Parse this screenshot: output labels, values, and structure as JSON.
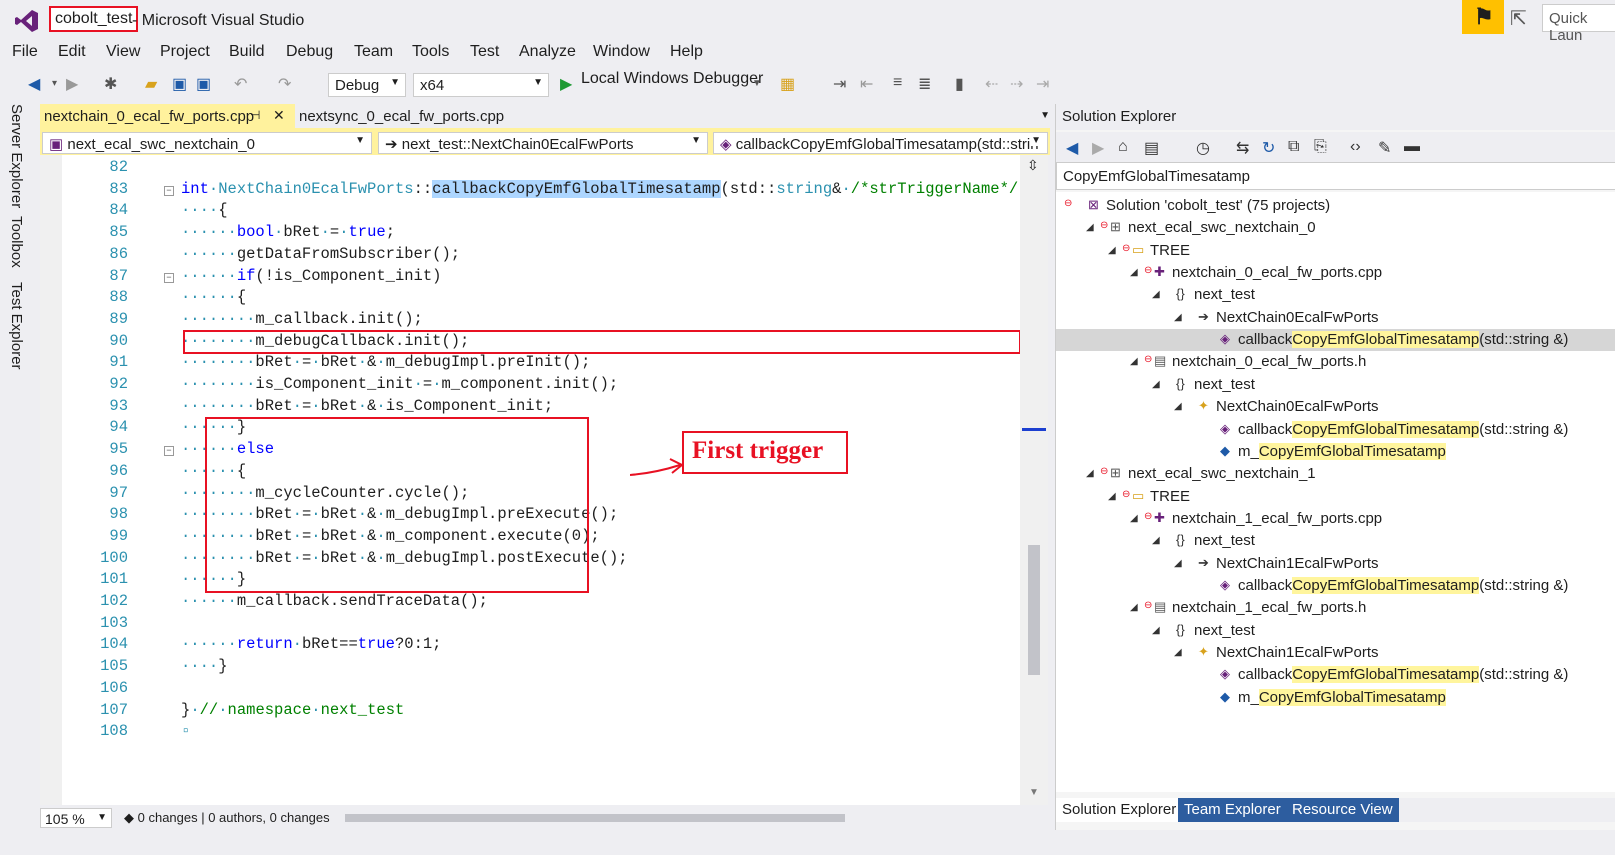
{
  "window": {
    "app_name": "cobolt_test",
    "title_suffix": " - Microsoft Visual Studio",
    "quick_launch_placeholder": "Quick Laun"
  },
  "menu": [
    "File",
    "Edit",
    "View",
    "Project",
    "Build",
    "Debug",
    "Team",
    "Tools",
    "Test",
    "Analyze",
    "Window",
    "Help"
  ],
  "toolbar": {
    "config": "Debug",
    "platform": "x64",
    "debugger": "Local Windows Debugger"
  },
  "side_tabs": [
    "Server Explorer",
    "Toolbox",
    "Test Explorer"
  ],
  "tabs": {
    "active": "nextchain_0_ecal_fw_ports.cpp",
    "pin": "⊣",
    "close": "✕",
    "inactive": "nextsync_0_ecal_fw_ports.cpp"
  },
  "nav": {
    "project": "next_ecal_swc_nextchain_0",
    "scope": "next_test::NextChain0EcalFwPorts",
    "member": "callbackCopyEmfGlobalTimesatamp(std::strin"
  },
  "code": {
    "lines": [
      {
        "n": "82",
        "html": ""
      },
      {
        "n": "83",
        "html": "<span class=\"kw\">int</span><span class=\"dot\">·</span><span class=\"ty\">NextChain0EcalFwPorts</span>::<span style=\"background:#add6ff\">callbackCopyEmfGlobalTimesatamp</span>(std::<span class=\"ty\">string</span>&amp;<span class=\"dot\">·</span><span class=\"cm\">/*strTriggerName*/</span>)"
      },
      {
        "n": "84",
        "html": "<span class=\"dot\">····</span>{"
      },
      {
        "n": "85",
        "html": "<span class=\"dot\">······</span><span class=\"kw\">bool</span><span class=\"dot\">·</span>bRet<span class=\"dot\">·</span>=<span class=\"dot\">·</span><span class=\"kw\">true</span>;"
      },
      {
        "n": "86",
        "html": "<span class=\"dot\">······</span>getDataFromSubscriber();"
      },
      {
        "n": "87",
        "html": "<span class=\"dot\">······</span><span class=\"kw\">if</span>(!is_Component_init)"
      },
      {
        "n": "88",
        "html": "<span class=\"dot\">······</span>{"
      },
      {
        "n": "89",
        "html": "<span class=\"dot\">········</span>m_callback.init();"
      },
      {
        "n": "90",
        "html": "<span class=\"dot\">········</span>m_debugCallback.init();"
      },
      {
        "n": "91",
        "html": "<span class=\"dot\">········</span>bRet<span class=\"dot\">·</span>=<span class=\"dot\">·</span>bRet<span class=\"dot\">·</span>&amp;<span class=\"dot\">·</span>m_debugImpl.preInit();"
      },
      {
        "n": "92",
        "html": "<span class=\"dot\">········</span>is_Component_init<span class=\"dot\">·</span>=<span class=\"dot\">·</span>m_component.init();"
      },
      {
        "n": "93",
        "html": "<span class=\"dot\">········</span>bRet<span class=\"dot\">·</span>=<span class=\"dot\">·</span>bRet<span class=\"dot\">·</span>&amp;<span class=\"dot\">·</span>is_Component_init;"
      },
      {
        "n": "94",
        "html": "<span class=\"dot\">······</span>}"
      },
      {
        "n": "95",
        "html": "<span class=\"dot\">······</span><span class=\"kw\">else</span>"
      },
      {
        "n": "96",
        "html": "<span class=\"dot\">······</span>{"
      },
      {
        "n": "97",
        "html": "<span class=\"dot\">········</span>m_cycleCounter.cycle();"
      },
      {
        "n": "98",
        "html": "<span class=\"dot\">········</span>bRet<span class=\"dot\">·</span>=<span class=\"dot\">·</span>bRet<span class=\"dot\">·</span>&amp;<span class=\"dot\">·</span>m_debugImpl.preExecute();"
      },
      {
        "n": "99",
        "html": "<span class=\"dot\">········</span>bRet<span class=\"dot\">·</span>=<span class=\"dot\">·</span>bRet<span class=\"dot\">·</span>&amp;<span class=\"dot\">·</span>m_component.execute(0);"
      },
      {
        "n": "100",
        "html": "<span class=\"dot\">········</span>bRet<span class=\"dot\">·</span>=<span class=\"dot\">·</span>bRet<span class=\"dot\">·</span>&amp;<span class=\"dot\">·</span>m_debugImpl.postExecute();"
      },
      {
        "n": "101",
        "html": "<span class=\"dot\">······</span>}"
      },
      {
        "n": "102",
        "html": "<span class=\"dot\">······</span>m_callback.sendTraceData();"
      },
      {
        "n": "103",
        "html": ""
      },
      {
        "n": "104",
        "html": "<span class=\"dot\">······</span><span class=\"kw\">return</span><span class=\"dot\">·</span>bRet==<span class=\"kw\">true</span>?0:1;"
      },
      {
        "n": "105",
        "html": "<span class=\"dot\">····</span>}"
      },
      {
        "n": "106",
        "html": ""
      },
      {
        "n": "107",
        "html": "}<span class=\"dot\">·</span><span class=\"cm\">//<span class=\"dot\">·</span>namespace<span class=\"dot\">·</span>next_test</span>"
      },
      {
        "n": "108",
        "html": "<span class=\"dot\">▫</span>"
      }
    ]
  },
  "callout": "First trigger",
  "status": {
    "zoom": "105 %",
    "changes": "0 changes | 0 authors, 0 changes"
  },
  "solution_explorer": {
    "title": "Solution Explorer",
    "search": "CopyEmfGlobalTimesatamp",
    "tree": [
      {
        "label": "Solution 'cobolt_test' (75 projects)",
        "d": 0,
        "ic": "sol",
        "exp": ""
      },
      {
        "label": "next_ecal_swc_nextchain_0",
        "d": 1,
        "ic": "proj",
        "exp": "◢"
      },
      {
        "label": "TREE",
        "d": 2,
        "ic": "folder",
        "exp": "◢"
      },
      {
        "label": "nextchain_0_ecal_fw_ports.cpp",
        "d": 3,
        "ic": "cpp",
        "exp": "◢"
      },
      {
        "label": "next_test",
        "d": 4,
        "ic": "ns",
        "exp": "◢"
      },
      {
        "label": "NextChain0EcalFwPorts",
        "d": 5,
        "ic": "arrow",
        "exp": "◢"
      },
      {
        "pre": "callback",
        "hl": "CopyEmfGlobalTimesatamp",
        "post": "(std::string &)",
        "d": 6,
        "ic": "method",
        "exp": "",
        "sel": true
      },
      {
        "label": "nextchain_0_ecal_fw_ports.h",
        "d": 3,
        "ic": "h",
        "exp": "◢"
      },
      {
        "label": "next_test",
        "d": 4,
        "ic": "ns",
        "exp": "◢"
      },
      {
        "label": "NextChain0EcalFwPorts",
        "d": 5,
        "ic": "class",
        "exp": "◢"
      },
      {
        "pre": "callback",
        "hl": "CopyEmfGlobalTimesatamp",
        "post": "(std::string &)",
        "d": 6,
        "ic": "method",
        "exp": ""
      },
      {
        "pre": "m_",
        "hl": "CopyEmfGlobalTimesatamp",
        "post": "",
        "d": 6,
        "ic": "field",
        "exp": ""
      },
      {
        "label": "next_ecal_swc_nextchain_1",
        "d": 1,
        "ic": "proj",
        "exp": "◢"
      },
      {
        "label": "TREE",
        "d": 2,
        "ic": "folder",
        "exp": "◢"
      },
      {
        "label": "nextchain_1_ecal_fw_ports.cpp",
        "d": 3,
        "ic": "cpp",
        "exp": "◢"
      },
      {
        "label": "next_test",
        "d": 4,
        "ic": "ns",
        "exp": "◢"
      },
      {
        "label": "NextChain1EcalFwPorts",
        "d": 5,
        "ic": "arrow",
        "exp": "◢"
      },
      {
        "pre": "callback",
        "hl": "CopyEmfGlobalTimesatamp",
        "post": "(std::string &)",
        "d": 6,
        "ic": "method",
        "exp": ""
      },
      {
        "label": "nextchain_1_ecal_fw_ports.h",
        "d": 3,
        "ic": "h",
        "exp": "◢"
      },
      {
        "label": "next_test",
        "d": 4,
        "ic": "ns",
        "exp": "◢"
      },
      {
        "label": "NextChain1EcalFwPorts",
        "d": 5,
        "ic": "class",
        "exp": "◢"
      },
      {
        "pre": "callback",
        "hl": "CopyEmfGlobalTimesatamp",
        "post": "(std::string &)",
        "d": 6,
        "ic": "method",
        "exp": ""
      },
      {
        "pre": "m_",
        "hl": "CopyEmfGlobalTimesatamp",
        "post": "",
        "d": 6,
        "ic": "field",
        "exp": ""
      }
    ],
    "tabs": [
      "Solution Explorer",
      "Team Explorer",
      "Resource View"
    ]
  },
  "colors": {
    "accent": "#68217a",
    "highlight": "#fff29d",
    "annotation": "#e81123"
  }
}
